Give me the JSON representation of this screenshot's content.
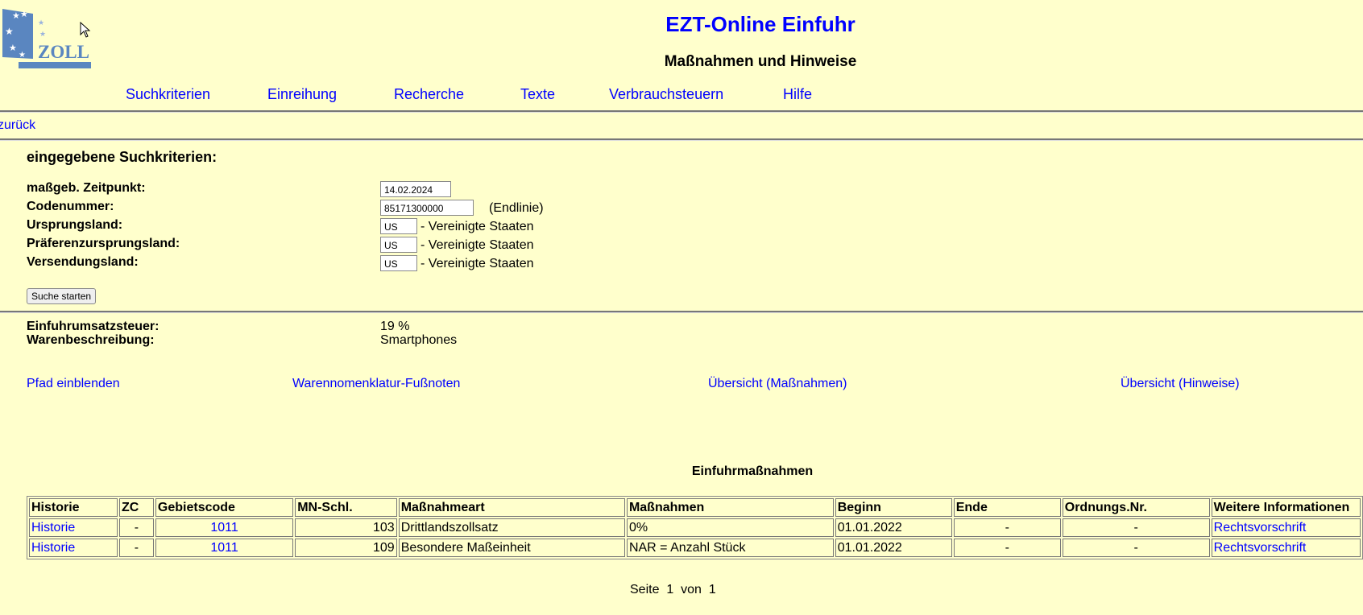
{
  "header": {
    "logo_text": "ZOLL",
    "title": "EZT-Online Einfuhr",
    "subtitle": "Maßnahmen und Hinweise"
  },
  "nav": [
    "Suchkriterien",
    "Einreihung",
    "Recherche",
    "Texte",
    "Verbrauchsteuern",
    "Hilfe"
  ],
  "back_link": "zurück",
  "criteria": {
    "heading": "eingegebene Suchkriterien:",
    "zeitpunkt_label": "maßgeb. Zeitpunkt:",
    "zeitpunkt_value": "14.02.2024",
    "code_label": "Codenummer:",
    "code_value": "85171300000",
    "code_note": "(Endlinie)",
    "ursprung_label": "Ursprungsland:",
    "ursprung_value": "US",
    "ursprung_name": "- Vereinigte Staaten",
    "praef_label": "Präferenzursprungsland:",
    "praef_value": "US",
    "praef_name": "- Vereinigte Staaten",
    "versand_label": "Versendungsland:",
    "versand_value": "US",
    "versand_name": "- Vereinigte Staaten",
    "search_button": "Suche starten"
  },
  "info": {
    "eust_label": "Einfuhrumsatzsteuer:",
    "eust_value": "19 %",
    "waren_label": "Warenbeschreibung:",
    "waren_value": "Smartphones"
  },
  "links": [
    "Pfad einblenden",
    "Warennomenklatur-Fußnoten",
    "Übersicht (Maßnahmen)",
    "Übersicht (Hinweise)"
  ],
  "table": {
    "title": "Einfuhrmaßnahmen",
    "headers": [
      "Historie",
      "ZC",
      "Gebietscode",
      "MN-Schl.",
      "Maßnahmeart",
      "Maßnahmen",
      "Beginn",
      "Ende",
      "Ordnungs.Nr.",
      "Weitere Informationen"
    ],
    "rows": [
      [
        "Historie",
        "-",
        "1011",
        "103",
        "Drittlandszollsatz",
        "0%",
        "01.01.2022",
        "-",
        "-",
        "Rechtsvorschrift"
      ],
      [
        "Historie",
        "-",
        "1011",
        "109",
        "Besondere Maßeinheit",
        "NAR = Anzahl Stück",
        "01.01.2022",
        "-",
        "-",
        "Rechtsvorschrift"
      ]
    ]
  },
  "pagination": {
    "label": "Seite",
    "current": "1",
    "of": "von",
    "total": "1"
  }
}
